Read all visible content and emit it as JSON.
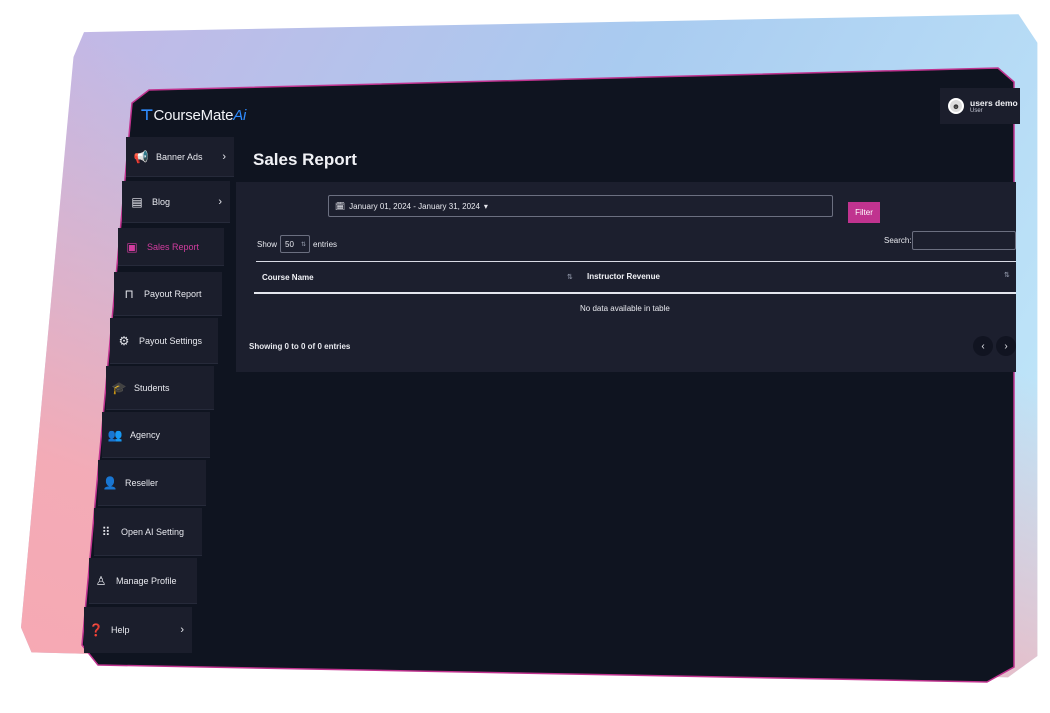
{
  "app": {
    "logo_prefix": "CourseMate",
    "logo_suffix": "Ai"
  },
  "user": {
    "name": "users demo",
    "role": "User"
  },
  "sidebar": {
    "items": [
      {
        "label": "Banner Ads",
        "icon": "megaphone-icon",
        "chevron": true
      },
      {
        "label": "Blog",
        "icon": "document-icon",
        "chevron": true
      },
      {
        "label": "Sales Report",
        "icon": "clipboard-icon",
        "chevron": false,
        "active": true
      },
      {
        "label": "Payout Report",
        "icon": "bag-icon",
        "chevron": false
      },
      {
        "label": "Payout Settings",
        "icon": "gear-icon",
        "chevron": false
      },
      {
        "label": "Students",
        "icon": "graduation-cap-icon",
        "chevron": false
      },
      {
        "label": "Agency",
        "icon": "users-icon",
        "chevron": false
      },
      {
        "label": "Reseller",
        "icon": "user-check-icon",
        "chevron": false
      },
      {
        "label": "Open AI Setting",
        "icon": "grid-icon",
        "chevron": false
      },
      {
        "label": "Manage Profile",
        "icon": "user-icon",
        "chevron": false
      },
      {
        "label": "Help",
        "icon": "question-icon",
        "chevron": true
      }
    ]
  },
  "main": {
    "title": "Sales Report",
    "date_range": "January 01, 2024 - January 31, 2024",
    "filter_label": "Filter",
    "show_label": "Show",
    "entries_value": "50",
    "entries_label": "entries",
    "search_label": "Search:",
    "search_value": "",
    "columns": [
      "Course Name",
      "Instructor Revenue"
    ],
    "empty_message": "No data available in table",
    "info": "Showing 0 to 0 of 0 entries",
    "prev_label": "‹",
    "next_label": "›"
  },
  "colors": {
    "accent": "#c0338f",
    "screen_bg": "#0f1420",
    "panel_bg": "#1c1f2e",
    "logo_ai": "#2f8cff"
  }
}
